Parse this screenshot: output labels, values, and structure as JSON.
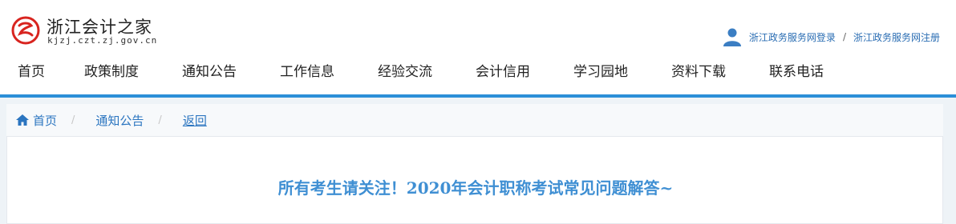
{
  "header": {
    "site_title": "浙江会计之家",
    "site_domain": "kjzj.czt.zj.gov.cn",
    "user_links": {
      "login": "浙江政务服务网登录",
      "separator": "/",
      "register": "浙江政务服务网注册"
    }
  },
  "nav": {
    "items": [
      {
        "label": "首页"
      },
      {
        "label": "政策制度"
      },
      {
        "label": "通知公告"
      },
      {
        "label": "工作信息"
      },
      {
        "label": "经验交流"
      },
      {
        "label": "会计信用"
      },
      {
        "label": "学习园地"
      },
      {
        "label": "资料下载"
      },
      {
        "label": "联系电话"
      }
    ]
  },
  "breadcrumb": {
    "home": "首页",
    "separator": "/",
    "section": "通知公告",
    "back": "返回"
  },
  "article": {
    "title": "所有考生请关注！2020年会计职称考试常见问题解答~"
  },
  "icons": {
    "logo": "zhejiang-logo",
    "user": "user-icon",
    "home": "home-icon"
  },
  "colors": {
    "nav_bar": "#2c8fd8",
    "link": "#2b75c0",
    "title": "#3f8fd3",
    "logo_red": "#d8241f"
  }
}
